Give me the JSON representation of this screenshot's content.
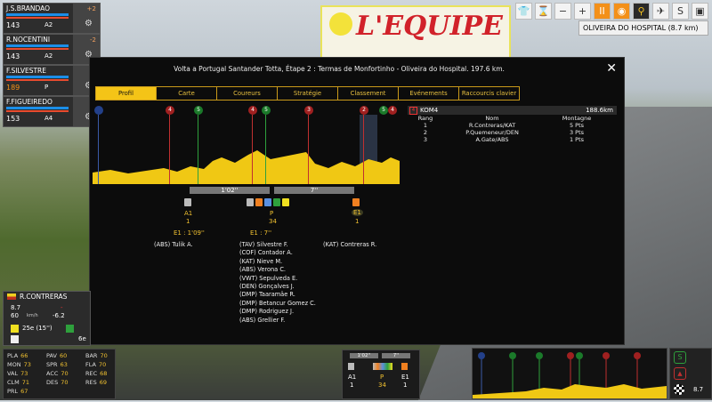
{
  "hud": {
    "location": "OLIVEIRA DO HOSPITAL (8.7 km)",
    "banner": "L'EQUIPE",
    "speed_btn": "II",
    "icons": [
      "shirt-icon",
      "hourglass-icon",
      "minus-icon",
      "plus-icon",
      "pause-icon",
      "eye-icon",
      "bike-icon",
      "helicopter-icon",
      "s-icon",
      "camera-icon"
    ]
  },
  "riders": [
    {
      "name": "J.S.BRANDAO",
      "val": "143",
      "cp": "A2",
      "gap": "+2"
    },
    {
      "name": "R.NOCENTINI",
      "val": "143",
      "cp": "A2",
      "gap": "-2"
    },
    {
      "name": "F.SILVESTRE",
      "val": "189",
      "cp": "P",
      "gap": "-"
    },
    {
      "name": "F.FIGUEIREDO",
      "val": "153",
      "cp": "A4",
      "gap": "-"
    }
  ],
  "panel": {
    "title": "Volta a Portugal Santander Totta, Étape 2 : Termas de Monfortinho - Oliveira do Hospital. 197.6 km.",
    "tabs": [
      "Profil",
      "Carte",
      "Coureurs",
      "Stratégie",
      "Classement",
      "Evénements",
      "Raccourcis clavier"
    ],
    "markers": [
      "4",
      "5",
      "4",
      "5",
      "3",
      "2",
      "5",
      "4"
    ],
    "kom": {
      "label": "KOM4",
      "km": "188.6km",
      "headers": [
        "Rang",
        "Nom",
        "Montagne"
      ],
      "rows": [
        [
          "1",
          "R.Contreras/KAT",
          "5 Pts"
        ],
        [
          "2",
          "P.Quemeneur/DEN",
          "3 Pts"
        ],
        [
          "3",
          "A.Gate/ABS",
          "1 Pts"
        ]
      ]
    },
    "gap1": "1'02''",
    "gap2": "7''",
    "groups": {
      "a1": "A1",
      "a1n": "1",
      "p": "P",
      "pn": "34",
      "e1": "E1",
      "e1n": "1",
      "e1a": "E1 : 1'09''",
      "e1b": "E1 : 7''"
    },
    "g1names": "(ABS) Tulik A.",
    "g2names": [
      "(TAV) Silvestre F.",
      "(COF) Contador A.",
      "(KAT) Nieve M.",
      "(ABS) Verona C.",
      "(VWT) Sepulveda E.",
      "(DEN) Gonçalves J.",
      "(DMP) Taaramäe R.",
      "(DMP) Betancur Gomez C.",
      "(DMP) Rodriguez J.",
      "(ABS) Grellier F."
    ],
    "g3names": "(KAT) Contreras R."
  },
  "leftbox": {
    "name": "R.CONTRERAS",
    "speed": "8.7",
    "speed2": "60",
    "unit": "km/h",
    "slope": "-6.2",
    "rank": "25e (15'')",
    "rank2": "6e",
    "dash": "-"
  },
  "stats": [
    [
      "PLA",
      "66"
    ],
    [
      "PAV",
      "60"
    ],
    [
      "BAR",
      "70"
    ],
    [
      "MON",
      "73"
    ],
    [
      "SPR",
      "63"
    ],
    [
      "FLA",
      "70"
    ],
    [
      "VAL",
      "73"
    ],
    [
      "ACC",
      "70"
    ],
    [
      "REC",
      "68"
    ],
    [
      "CLM",
      "71"
    ],
    [
      "DES",
      "70"
    ],
    [
      "RES",
      "69"
    ],
    [
      "PRL",
      "67"
    ]
  ],
  "mini": {
    "gap1": "1'02''",
    "gap2": "7''",
    "a1": "A1",
    "a1n": "1",
    "p": "P",
    "pn": "34",
    "e1": "E1",
    "e1n": "1",
    "dist": "8.7"
  }
}
